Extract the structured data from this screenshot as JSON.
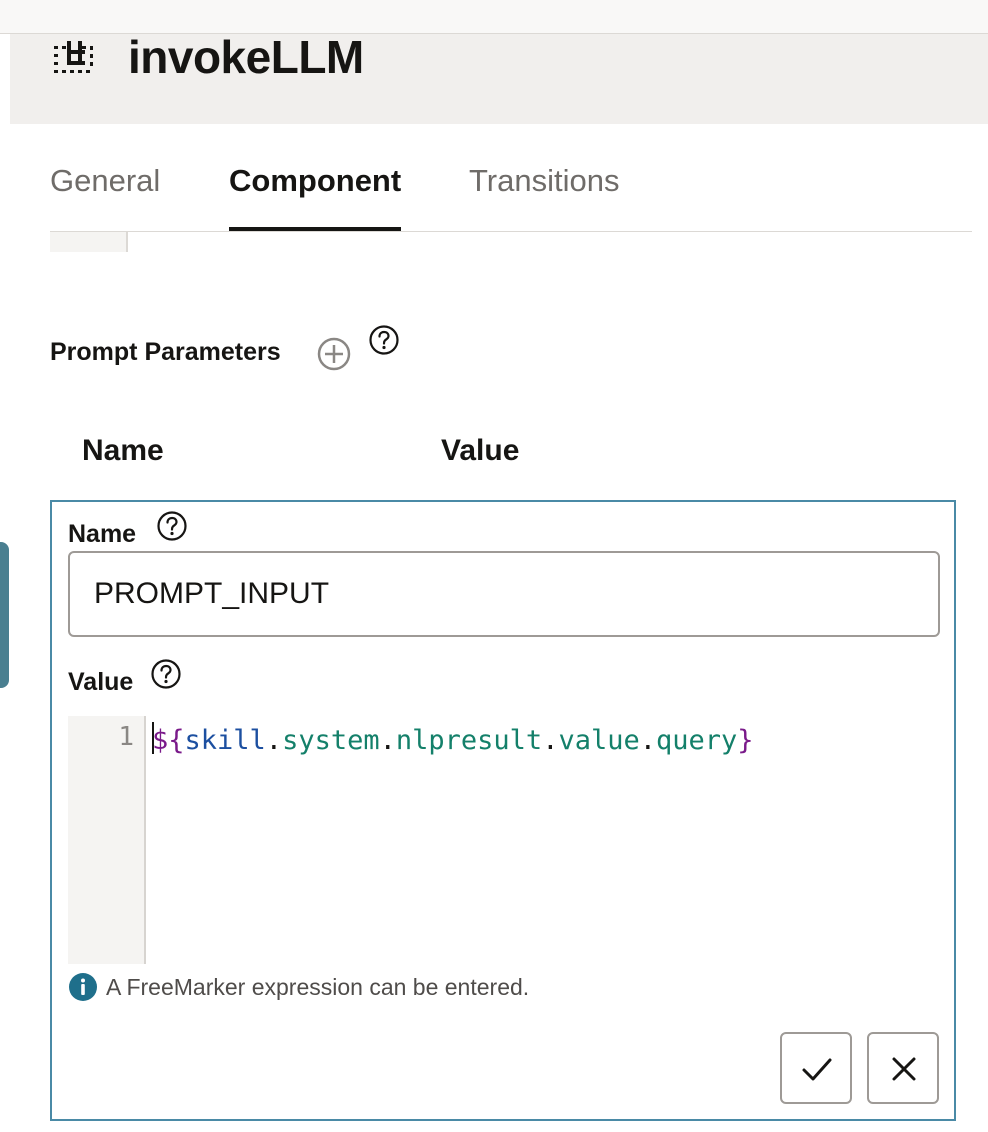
{
  "header": {
    "title": "invokeLLM",
    "icon": "component-icon"
  },
  "tabs": [
    {
      "label": "General",
      "active": false
    },
    {
      "label": "Component",
      "active": true
    },
    {
      "label": "Transitions",
      "active": false
    }
  ],
  "prompt_parameters": {
    "title": "Prompt Parameters",
    "columns": {
      "name": "Name",
      "value": "Value"
    }
  },
  "editor": {
    "name_label": "Name",
    "name_value": "PROMPT_INPUT",
    "value_label": "Value",
    "code": {
      "line_number": "1",
      "tokens": {
        "open": "${",
        "skill": "skill",
        "dot1": ".",
        "system": "system",
        "dot2": ".",
        "nlpresult": "nlpresult",
        "dot3": ".",
        "value": "value",
        "dot4": ".",
        "query": "query",
        "close": "}"
      }
    },
    "hint": "A FreeMarker expression can be entered."
  },
  "colors": {
    "accent_border": "#4a8aa6",
    "info_icon": "#1f6f8b",
    "token_delim": "#7a1a8a",
    "token_skill": "#1c4fa0",
    "token_prop": "#14806a"
  }
}
